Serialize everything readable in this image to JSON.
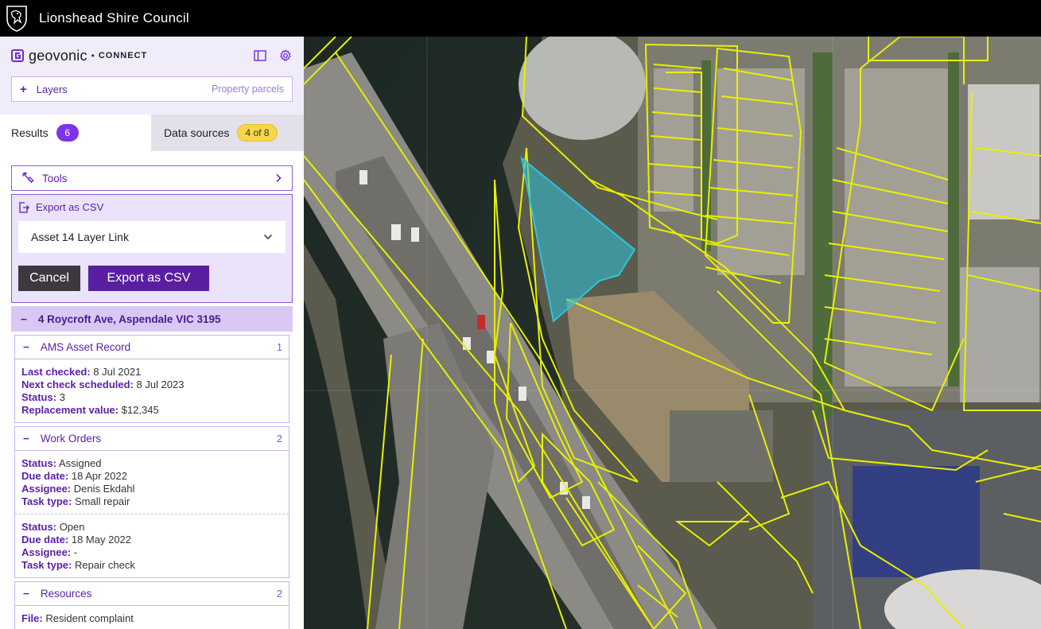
{
  "header": {
    "title": "Lionshead Shire Council"
  },
  "brand": {
    "name": "geovonic",
    "sep": "•",
    "product": "CONNECT"
  },
  "layers": {
    "plus": "+",
    "label": "Layers",
    "value": "Property parcels"
  },
  "tabs": {
    "results": {
      "label": "Results",
      "count": "6"
    },
    "sources": {
      "label": "Data sources",
      "count": "4 of 8"
    }
  },
  "tools": {
    "label": "Tools"
  },
  "export": {
    "title": "Export as CSV",
    "selected": "Asset 14 Layer Link",
    "cancel": "Cancel",
    "submit": "Export as CSV"
  },
  "address": {
    "toggle": "−",
    "label": "4 Roycroft Ave, Aspendale VIC 3195"
  },
  "groups": [
    {
      "toggle": "−",
      "title": "AMS Asset Record",
      "count": "1",
      "records": [
        [
          {
            "k": "Last checked:",
            "v": "8 Jul 2021"
          },
          {
            "k": "Next check scheduled:",
            "v": "8 Jul 2023"
          },
          {
            "k": "Status:",
            "v": "3"
          },
          {
            "k": "Replacement value:",
            "v": "$12,345"
          }
        ]
      ]
    },
    {
      "toggle": "−",
      "title": "Work Orders",
      "count": "2",
      "records": [
        [
          {
            "k": "Status:",
            "v": "Assigned"
          },
          {
            "k": "Due date:",
            "v": "18 Apr 2022"
          },
          {
            "k": "Assignee:",
            "v": "Denis Ekdahl"
          },
          {
            "k": "Task type:",
            "v": "Small repair"
          }
        ],
        [
          {
            "k": "Status:",
            "v": "Open"
          },
          {
            "k": "Due date:",
            "v": "18 May 2022"
          },
          {
            "k": "Assignee:",
            "v": "-"
          },
          {
            "k": "Task type:",
            "v": "Repair check"
          }
        ]
      ]
    },
    {
      "toggle": "−",
      "title": "Resources",
      "count": "2",
      "records": [
        [
          {
            "k": "File:",
            "v": "Resident complaint"
          }
        ]
      ]
    }
  ],
  "colors": {
    "accent": "#5b1fa8",
    "badge_purple": "#7d33e6",
    "badge_yellow": "#f7d64a",
    "parcel_outline": "#e8f000",
    "selected_parcel": "#2fc4dc"
  },
  "icons": [
    "crest-icon",
    "brand-logo-icon",
    "panel-toggle-icon",
    "gear-icon",
    "tools-icon",
    "chevron-right-icon",
    "export-icon",
    "chevron-down-icon"
  ]
}
